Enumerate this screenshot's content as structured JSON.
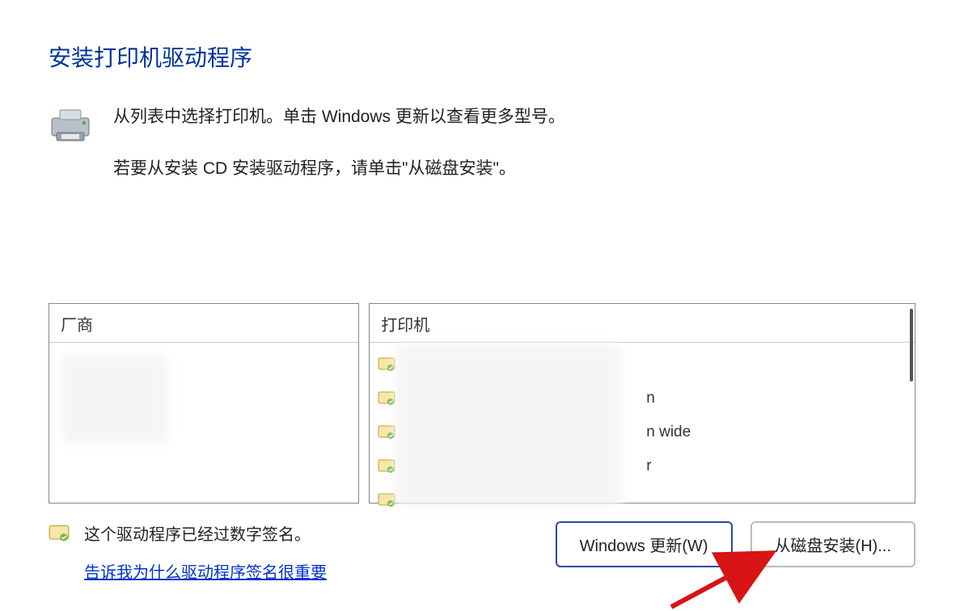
{
  "title": "安装打印机驱动程序",
  "instructions": {
    "line1": "从列表中选择打印机。单击 Windows 更新以查看更多型号。",
    "line2": "若要从安装 CD 安装驱动程序，请单击\"从磁盘安装\"。"
  },
  "manufacturer": {
    "header": "厂商"
  },
  "printers": {
    "header": "打印机",
    "items": [
      {
        "suffix": ""
      },
      {
        "suffix": "n"
      },
      {
        "suffix": "n wide"
      },
      {
        "suffix": "r"
      },
      {
        "suffix": ""
      }
    ]
  },
  "signature": {
    "text": "这个驱动程序已经过数字签名。",
    "link": "告诉我为什么驱动程序签名很重要"
  },
  "buttons": {
    "windows_update": "Windows 更新(W)",
    "from_disk": "从磁盘安装(H)..."
  }
}
